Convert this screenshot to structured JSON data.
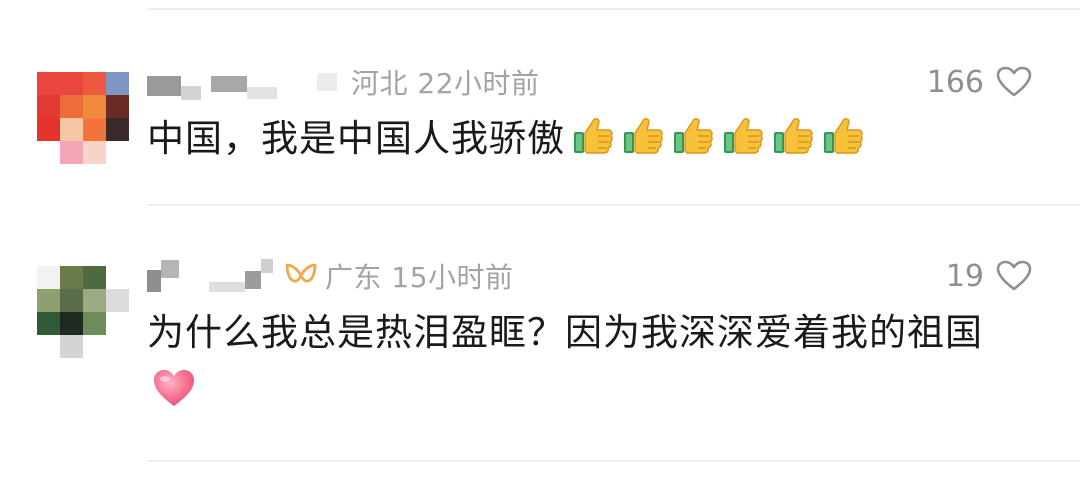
{
  "comments": [
    {
      "location": "河北",
      "time": "22小时前",
      "likes": "166",
      "text": "中国，我是中国人我骄傲",
      "emoji": "thumbs-up-icon",
      "emoji_count": 6
    },
    {
      "location": "广东",
      "time": "15小时前",
      "likes": "19",
      "text": "为什么我总是热泪盈眶？因为我深深爱着我的祖国",
      "emoji": "pink-heart-icon",
      "badge": "fans-badge-icon"
    }
  ],
  "colors": {
    "meta_text": "#a3a3a3",
    "like_count": "#8f8f8f",
    "comment_text": "#1a1a1a",
    "badge": "#f0a84a",
    "thumb": "#f7c23a",
    "heart": "#f06a8c"
  }
}
